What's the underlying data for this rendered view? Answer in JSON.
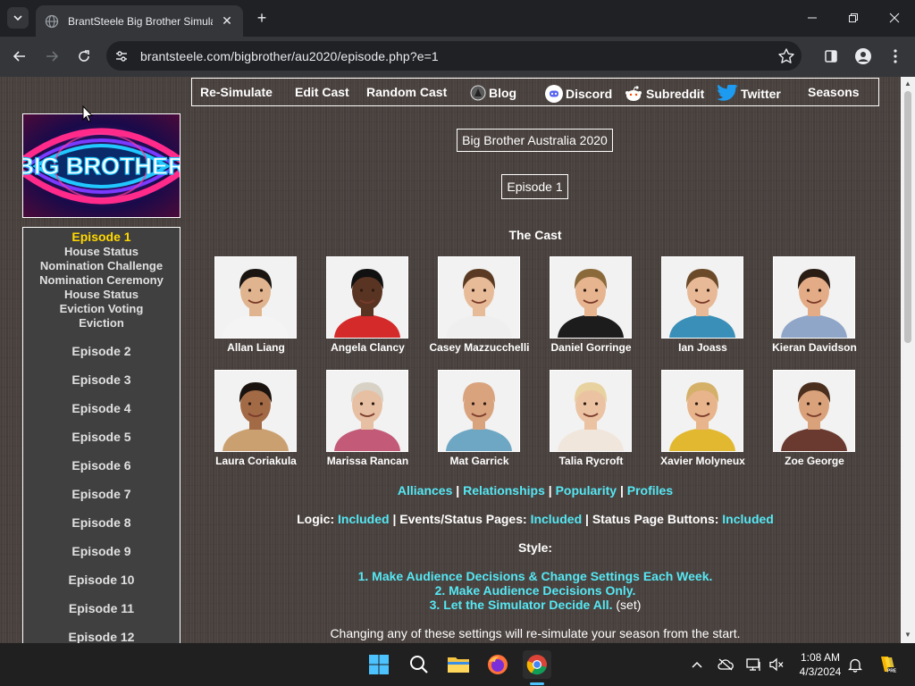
{
  "browser": {
    "tab_title": "BrantSteele Big Brother Simulat",
    "url": "brantsteele.com/bigbrother/au2020/episode.php?e=1"
  },
  "nav": {
    "items": [
      "Re-Simulate",
      "Edit Cast",
      "Random Cast",
      "Blog",
      "Discord",
      "Subreddit",
      "Twitter",
      "Seasons"
    ]
  },
  "logo": {
    "text": "BIG BROTHER"
  },
  "sidebar": {
    "current_episode": "Episode 1",
    "sub_items": [
      "House Status",
      "Nomination Challenge",
      "Nomination Ceremony",
      "House Status",
      "Eviction Voting",
      "Eviction"
    ],
    "episodes": [
      "Episode 2",
      "Episode 3",
      "Episode 4",
      "Episode 5",
      "Episode 6",
      "Episode 7",
      "Episode 8",
      "Episode 9",
      "Episode 10",
      "Episode 11",
      "Episode 12"
    ]
  },
  "main": {
    "season_title": "Big Brother Australia 2020",
    "episode_title": "Episode 1",
    "cast_heading": "The Cast",
    "cast": [
      {
        "name": "Allan Liang",
        "skin": "#e0b48e",
        "hair": "#1b1512",
        "shirt": "#f4f4f4",
        "bg": "#f2f2f2"
      },
      {
        "name": "Angela Clancy",
        "skin": "#5a3422",
        "hair": "#111111",
        "shirt": "#d42a2a",
        "bg": "#f2f2f2"
      },
      {
        "name": "Casey Mazzucchelli",
        "skin": "#e7bb98",
        "hair": "#5a3a22",
        "shirt": "#efefef",
        "bg": "#f2f2f2"
      },
      {
        "name": "Daniel Gorringe",
        "skin": "#e6b48f",
        "hair": "#8a6a3a",
        "shirt": "#1c1c1c",
        "bg": "#f2f2f2"
      },
      {
        "name": "Ian Joass",
        "skin": "#e8b996",
        "hair": "#6b4a2a",
        "shirt": "#3a8fb8",
        "bg": "#f2f2f2"
      },
      {
        "name": "Kieran Davidson",
        "skin": "#e3ac86",
        "hair": "#2a1d14",
        "shirt": "#8fa6c8",
        "bg": "#f2f2f2"
      },
      {
        "name": "Laura Coriakula",
        "skin": "#a36a46",
        "hair": "#1a120e",
        "shirt": "#caa070",
        "bg": "#f2f2f2"
      },
      {
        "name": "Marissa Rancan",
        "skin": "#e7bfa3",
        "hair": "#d8d2c6",
        "shirt": "#c25a78",
        "bg": "#f2f2f2"
      },
      {
        "name": "Mat Garrick",
        "skin": "#d9a37e",
        "hair": "#d9a37e",
        "shirt": "#6ea7c4",
        "bg": "#f2f2f2"
      },
      {
        "name": "Talia Rycroft",
        "skin": "#ebc3a2",
        "hair": "#e8d2a0",
        "shirt": "#f0e6dc",
        "bg": "#f2f2f2"
      },
      {
        "name": "Xavier Molyneux",
        "skin": "#e8b48c",
        "hair": "#d4b068",
        "shirt": "#e2b830",
        "bg": "#f2f2f2"
      },
      {
        "name": "Zoe George",
        "skin": "#d9a27a",
        "hair": "#4a2e1e",
        "shirt": "#6a3a30",
        "bg": "#f2f2f2"
      }
    ],
    "links": [
      "Alliances",
      "Relationships",
      "Popularity",
      "Profiles"
    ],
    "logic_line": {
      "logic_label": "Logic:",
      "logic_value": "Included",
      "events_label": "Events/Status Pages:",
      "events_value": "Included",
      "buttons_label": "Status Page Buttons:",
      "buttons_value": "Included"
    },
    "style_heading": "Style:",
    "style_options": [
      "1. Make Audience Decisions & Change Settings Each Week.",
      "2. Make Audience Decisions Only.",
      "3. Let the Simulator Decide All."
    ],
    "style_set_note": "(set)",
    "resim_warning": "Changing any of these settings will re-simulate your season from the start."
  },
  "taskbar": {
    "time": "1:08 AM",
    "date": "4/3/2024"
  },
  "colors": {
    "accent_cyan": "#55e8f4",
    "current_episode_yellow": "#ffd800",
    "page_background": "#4a423f",
    "sidebar_background": "#404040"
  }
}
